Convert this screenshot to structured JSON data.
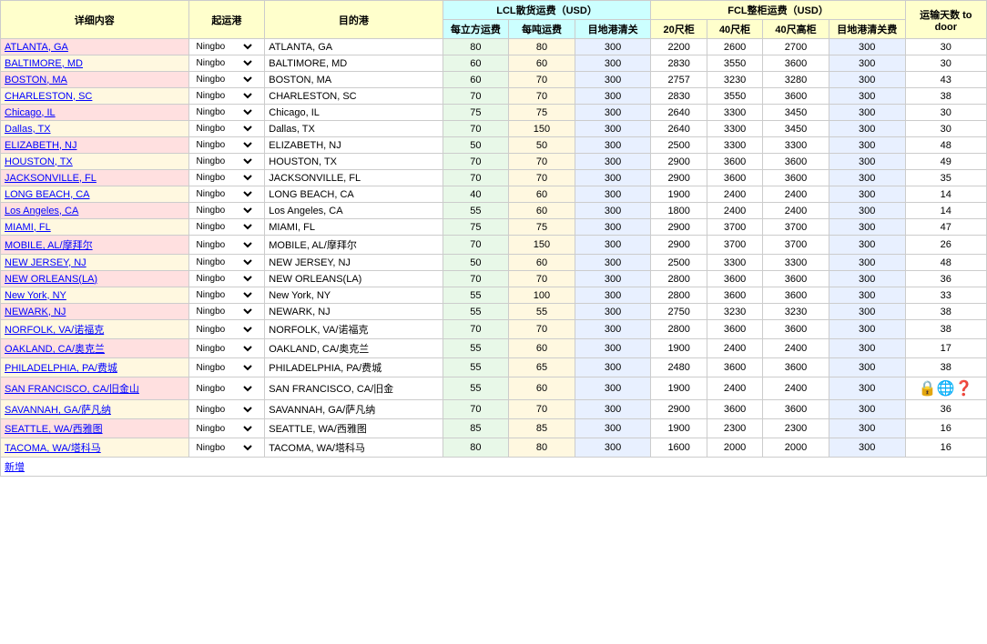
{
  "headers": {
    "detail": "详细内容",
    "origin": "起运港",
    "dest": "目的港",
    "lcl_group": "LCL散货运费（USD）",
    "fcl_group": "FCL整柜运费（USD）",
    "lcl_cbm": "每立方运费",
    "lcl_ton": "每吨运费",
    "lcl_cus": "目地港清关",
    "fcl_20": "20尺柜",
    "fcl_40": "40尺柜",
    "fcl_40hq": "40尺高柜",
    "fcl_cus": "目地港清关费",
    "days": "运输天数 to door"
  },
  "rows": [
    {
      "detail": "ATLANTA, GA",
      "origin": "Ningbo",
      "dest": "ATLANTA, GA",
      "lcl_cbm": 80,
      "lcl_ton": 80,
      "lcl_cus": 300,
      "fcl_20": 2200,
      "fcl_40": 2600,
      "fcl_40hq": 2700,
      "fcl_cus": 300,
      "days": 30
    },
    {
      "detail": "BALTIMORE, MD",
      "origin": "Ningbo",
      "dest": "BALTIMORE, MD",
      "lcl_cbm": 60,
      "lcl_ton": 60,
      "lcl_cus": 300,
      "fcl_20": 2830,
      "fcl_40": 3550,
      "fcl_40hq": 3600,
      "fcl_cus": 300,
      "days": 30
    },
    {
      "detail": "BOSTON, MA",
      "origin": "Ningbo",
      "dest": "BOSTON, MA",
      "lcl_cbm": 60,
      "lcl_ton": 70,
      "lcl_cus": 300,
      "fcl_20": 2757,
      "fcl_40": 3230,
      "fcl_40hq": 3280,
      "fcl_cus": 300,
      "days": 43
    },
    {
      "detail": "CHARLESTON, SC",
      "origin": "Ningbo",
      "dest": "CHARLESTON, SC",
      "lcl_cbm": 70,
      "lcl_ton": 70,
      "lcl_cus": 300,
      "fcl_20": 2830,
      "fcl_40": 3550,
      "fcl_40hq": 3600,
      "fcl_cus": 300,
      "days": 38
    },
    {
      "detail": "Chicago, IL",
      "origin": "Ningbo",
      "dest": "Chicago, IL",
      "lcl_cbm": 75,
      "lcl_ton": 75,
      "lcl_cus": 300,
      "fcl_20": 2640,
      "fcl_40": 3300,
      "fcl_40hq": 3450,
      "fcl_cus": 300,
      "days": 30
    },
    {
      "detail": "Dallas, TX",
      "origin": "Ningbo",
      "dest": "Dallas, TX",
      "lcl_cbm": 70,
      "lcl_ton": 150,
      "lcl_cus": 300,
      "fcl_20": 2640,
      "fcl_40": 3300,
      "fcl_40hq": 3450,
      "fcl_cus": 300,
      "days": 30
    },
    {
      "detail": "ELIZABETH, NJ",
      "origin": "Ningbo",
      "dest": "ELIZABETH, NJ",
      "lcl_cbm": 50,
      "lcl_ton": 50,
      "lcl_cus": 300,
      "fcl_20": 2500,
      "fcl_40": 3300,
      "fcl_40hq": 3300,
      "fcl_cus": 300,
      "days": 48
    },
    {
      "detail": "HOUSTON, TX",
      "origin": "Ningbo",
      "dest": "HOUSTON, TX",
      "lcl_cbm": 70,
      "lcl_ton": 70,
      "lcl_cus": 300,
      "fcl_20": 2900,
      "fcl_40": 3600,
      "fcl_40hq": 3600,
      "fcl_cus": 300,
      "days": 49
    },
    {
      "detail": "JACKSONVILLE, FL",
      "origin": "Ningbo",
      "dest": "JACKSONVILLE, FL",
      "lcl_cbm": 70,
      "lcl_ton": 70,
      "lcl_cus": 300,
      "fcl_20": 2900,
      "fcl_40": 3600,
      "fcl_40hq": 3600,
      "fcl_cus": 300,
      "days": 35
    },
    {
      "detail": "LONG BEACH, CA",
      "origin": "Ningbo",
      "dest": "LONG BEACH, CA",
      "lcl_cbm": 40,
      "lcl_ton": 60,
      "lcl_cus": 300,
      "fcl_20": 1900,
      "fcl_40": 2400,
      "fcl_40hq": 2400,
      "fcl_cus": 300,
      "days": 14
    },
    {
      "detail": "Los Angeles, CA",
      "origin": "Ningbo",
      "dest": "Los Angeles, CA",
      "lcl_cbm": 55,
      "lcl_ton": 60,
      "lcl_cus": 300,
      "fcl_20": 1800,
      "fcl_40": 2400,
      "fcl_40hq": 2400,
      "fcl_cus": 300,
      "days": 14
    },
    {
      "detail": "MIAMI, FL",
      "origin": "Ningbo",
      "dest": "MIAMI, FL",
      "lcl_cbm": 75,
      "lcl_ton": 75,
      "lcl_cus": 300,
      "fcl_20": 2900,
      "fcl_40": 3700,
      "fcl_40hq": 3700,
      "fcl_cus": 300,
      "days": 47
    },
    {
      "detail": "MOBILE, AL/摩拜尔",
      "origin": "Ningbo",
      "dest": "MOBILE, AL/摩拜尔",
      "lcl_cbm": 70,
      "lcl_ton": 150,
      "lcl_cus": 300,
      "fcl_20": 2900,
      "fcl_40": 3700,
      "fcl_40hq": 3700,
      "fcl_cus": 300,
      "days": 26
    },
    {
      "detail": "NEW JERSEY, NJ",
      "origin": "Ningbo",
      "dest": "NEW JERSEY, NJ",
      "lcl_cbm": 50,
      "lcl_ton": 60,
      "lcl_cus": 300,
      "fcl_20": 2500,
      "fcl_40": 3300,
      "fcl_40hq": 3300,
      "fcl_cus": 300,
      "days": 48
    },
    {
      "detail": "NEW ORLEANS(LA)",
      "origin": "Ningbo",
      "dest": "NEW ORLEANS(LA)",
      "lcl_cbm": 70,
      "lcl_ton": 70,
      "lcl_cus": 300,
      "fcl_20": 2800,
      "fcl_40": 3600,
      "fcl_40hq": 3600,
      "fcl_cus": 300,
      "days": 36
    },
    {
      "detail": "New York, NY",
      "origin": "Ningbo",
      "dest": "New York, NY",
      "lcl_cbm": 55,
      "lcl_ton": 100,
      "lcl_cus": 300,
      "fcl_20": 2800,
      "fcl_40": 3600,
      "fcl_40hq": 3600,
      "fcl_cus": 300,
      "days": 33
    },
    {
      "detail": "NEWARK, NJ",
      "origin": "Ningbo",
      "dest": "NEWARK, NJ",
      "lcl_cbm": 55,
      "lcl_ton": 55,
      "lcl_cus": 300,
      "fcl_20": 2750,
      "fcl_40": 3230,
      "fcl_40hq": 3230,
      "fcl_cus": 300,
      "days": 38
    },
    {
      "detail": "NORFOLK, VA/诺福克",
      "origin": "Ningbo",
      "dest": "NORFOLK, VA/诺福克",
      "lcl_cbm": 70,
      "lcl_ton": 70,
      "lcl_cus": 300,
      "fcl_20": 2800,
      "fcl_40": 3600,
      "fcl_40hq": 3600,
      "fcl_cus": 300,
      "days": 38
    },
    {
      "detail": "OAKLAND, CA/奥克兰",
      "origin": "Ningbo",
      "dest": "OAKLAND, CA/奥克兰",
      "lcl_cbm": 55,
      "lcl_ton": 60,
      "lcl_cus": 300,
      "fcl_20": 1900,
      "fcl_40": 2400,
      "fcl_40hq": 2400,
      "fcl_cus": 300,
      "days": 17
    },
    {
      "detail": "PHILADELPHIA, PA/费城",
      "origin": "Ningbo",
      "dest": "PHILADELPHIA, PA/费城",
      "lcl_cbm": 55,
      "lcl_ton": 65,
      "lcl_cus": 300,
      "fcl_20": 2480,
      "fcl_40": 3600,
      "fcl_40hq": 3600,
      "fcl_cus": 300,
      "days": 38
    },
    {
      "detail": "SAN FRANCISCO, CA/旧金山",
      "origin": "Ningbo",
      "dest": "SAN FRANCISCO, CA/旧金",
      "lcl_cbm": 55,
      "lcl_ton": 60,
      "lcl_cus": 300,
      "fcl_20": 1900,
      "fcl_40": 2400,
      "fcl_40hq": 2400,
      "fcl_cus": 300,
      "days": ""
    },
    {
      "detail": "SAVANNAH, GA/萨凡纳",
      "origin": "Ningbo",
      "dest": "SAVANNAH, GA/萨凡纳",
      "lcl_cbm": 70,
      "lcl_ton": 70,
      "lcl_cus": 300,
      "fcl_20": 2900,
      "fcl_40": 3600,
      "fcl_40hq": 3600,
      "fcl_cus": 300,
      "days": 36
    },
    {
      "detail": "SEATTLE, WA/西雅图",
      "origin": "Ningbo",
      "dest": "SEATTLE, WA/西雅图",
      "lcl_cbm": 85,
      "lcl_ton": 85,
      "lcl_cus": 300,
      "fcl_20": 1900,
      "fcl_40": 2300,
      "fcl_40hq": 2300,
      "fcl_cus": 300,
      "days": 16
    },
    {
      "detail": "TACOMA, WA/塔科马",
      "origin": "Ningbo",
      "dest": "TACOMA, WA/塔科马",
      "lcl_cbm": 80,
      "lcl_ton": 80,
      "lcl_cus": 300,
      "fcl_20": 1600,
      "fcl_40": 2000,
      "fcl_40hq": 2000,
      "fcl_cus": 300,
      "days": 16
    }
  ],
  "footer": {
    "add_label": "新增"
  }
}
